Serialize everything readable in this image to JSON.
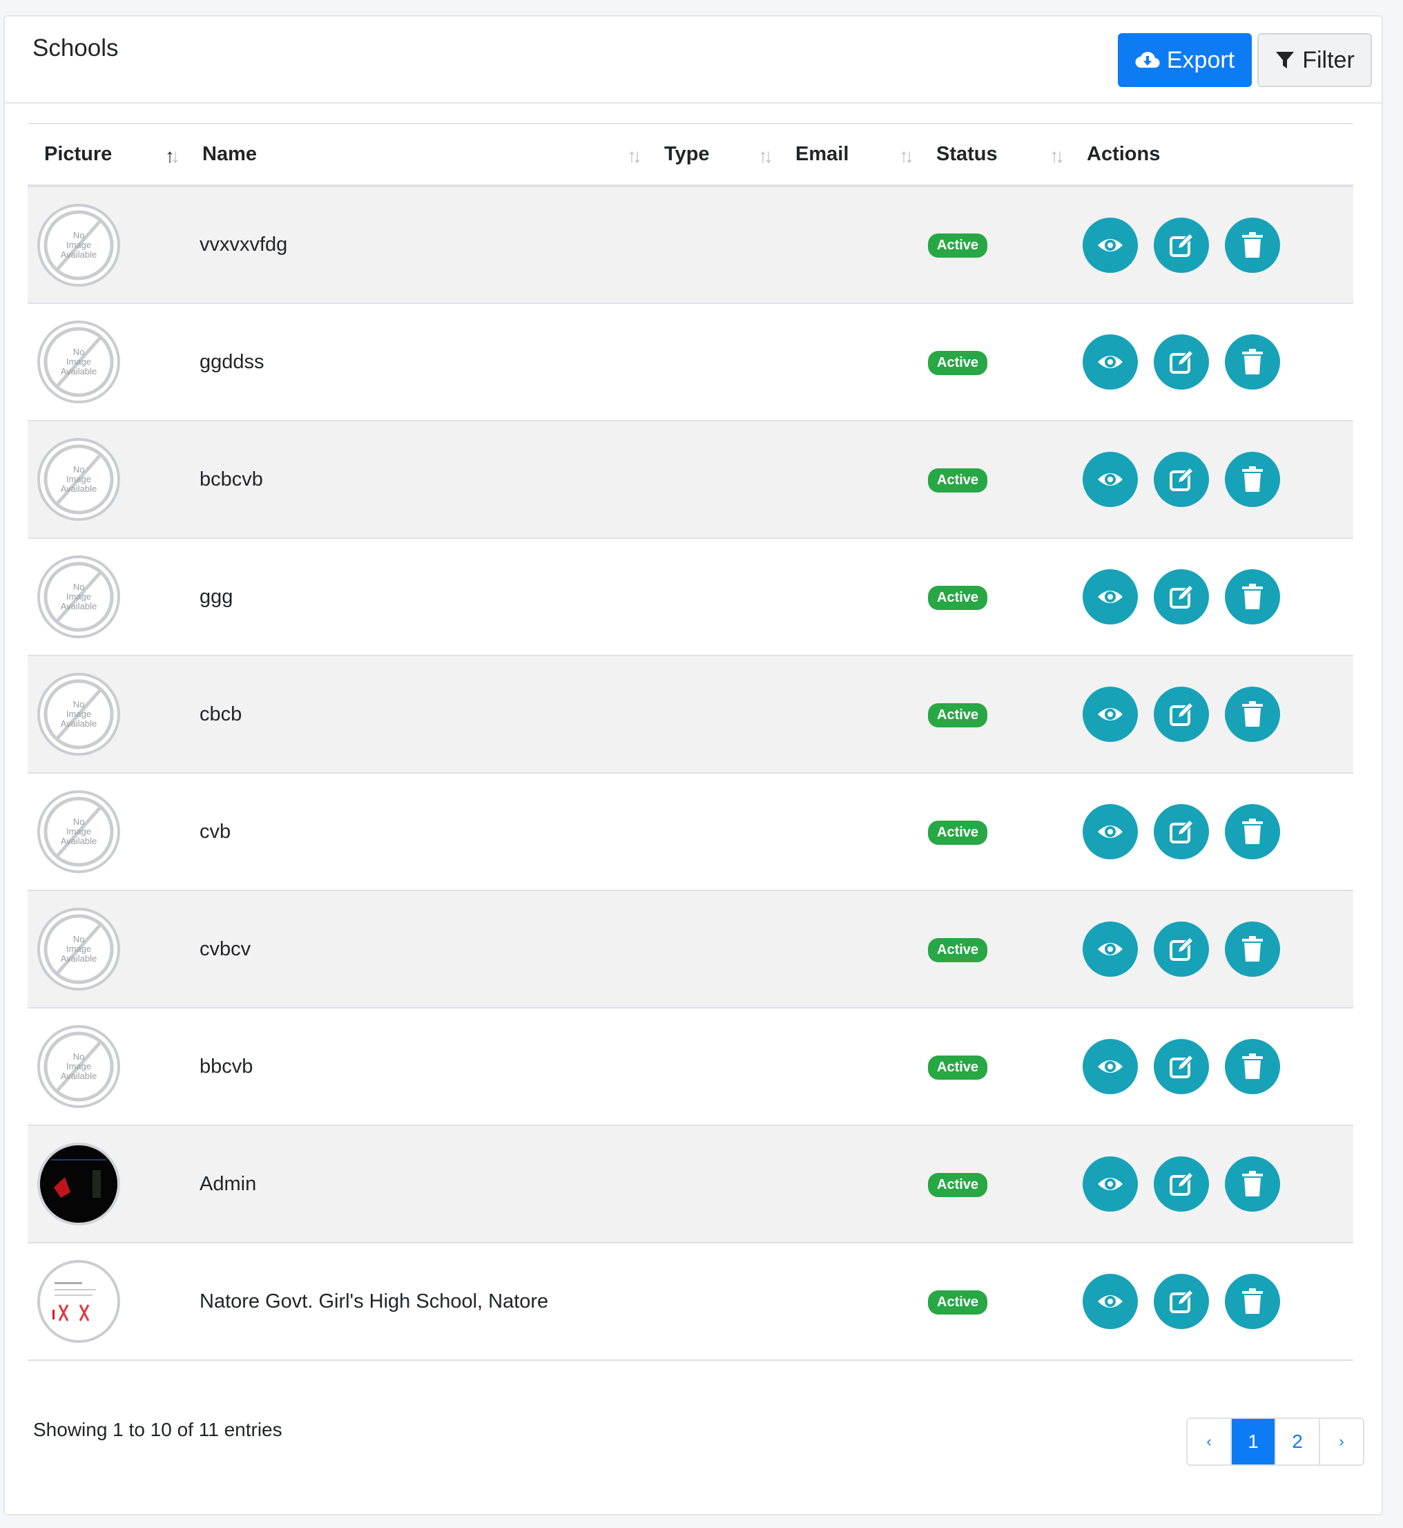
{
  "header": {
    "title": "Schools",
    "export_label": "Export",
    "filter_label": "Filter"
  },
  "table": {
    "columns": [
      {
        "label": "Picture",
        "sort": "asc"
      },
      {
        "label": "Name",
        "sort": "none"
      },
      {
        "label": "Type",
        "sort": "none"
      },
      {
        "label": "Email",
        "sort": "none"
      },
      {
        "label": "Status",
        "sort": "none"
      },
      {
        "label": "Actions",
        "sort": ""
      }
    ],
    "rows": [
      {
        "picture": "no-image",
        "name": "vvxvxvfdg",
        "type": "",
        "email": "",
        "status": "Active"
      },
      {
        "picture": "no-image",
        "name": "ggddss",
        "type": "",
        "email": "",
        "status": "Active"
      },
      {
        "picture": "no-image",
        "name": "bcbcvb",
        "type": "",
        "email": "",
        "status": "Active"
      },
      {
        "picture": "no-image",
        "name": "ggg",
        "type": "",
        "email": "",
        "status": "Active"
      },
      {
        "picture": "no-image",
        "name": "cbcb",
        "type": "",
        "email": "",
        "status": "Active"
      },
      {
        "picture": "no-image",
        "name": "cvb",
        "type": "",
        "email": "",
        "status": "Active"
      },
      {
        "picture": "no-image",
        "name": "cvbcv",
        "type": "",
        "email": "",
        "status": "Active"
      },
      {
        "picture": "no-image",
        "name": "bbcvb",
        "type": "",
        "email": "",
        "status": "Active"
      },
      {
        "picture": "screenshot-dark",
        "name": "Admin",
        "type": "",
        "email": "",
        "status": "Active"
      },
      {
        "picture": "document-thumb",
        "name": "Natore Govt. Girl's High School, Natore",
        "type": "",
        "email": "",
        "status": "Active"
      }
    ],
    "no_image_text": [
      "No",
      "Image",
      "Available"
    ]
  },
  "footer": {
    "info": "Showing 1 to 10 of 11 entries",
    "pagination": {
      "prev": "‹",
      "pages": [
        "1",
        "2"
      ],
      "current": "1",
      "next": "›"
    }
  },
  "colors": {
    "primary": "#0d7bf4",
    "action": "#17a2b8",
    "badge_active": "#28a745"
  },
  "icons": {
    "export": "cloud-download-icon",
    "filter": "funnel-icon",
    "view": "eye-icon",
    "edit": "edit-icon",
    "delete": "trash-icon"
  }
}
